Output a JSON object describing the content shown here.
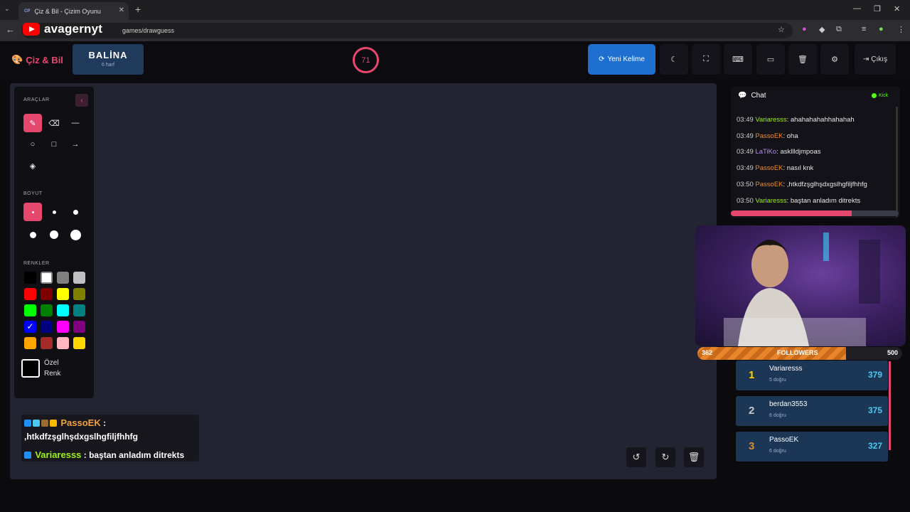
{
  "browser": {
    "tab_title": "Çiz & Bil - Çizim Oyunu",
    "tab_favicon": "CP",
    "url": "games/drawguess",
    "overlay_channel": "avagernyt"
  },
  "header": {
    "brand": "Çiz & Bil",
    "word": "BALİNA",
    "word_length": "6 harf",
    "timer": "71",
    "new_word_label": "Yeni Kelime",
    "exit_label": "Çıkış"
  },
  "tools": {
    "tools_label": "ARAÇLAR",
    "size_label": "BOYUT",
    "colors_label": "RENKLER",
    "custom_color_label_1": "Özel",
    "custom_color_label_2": "Renk",
    "palette": [
      "#000000",
      "#ffffff",
      "#808080",
      "#c0c0c0",
      "#ff0000",
      "#800000",
      "#ffff00",
      "#808000",
      "#00ff00",
      "#008000",
      "#00ffff",
      "#008080",
      "#0000ff",
      "#000080",
      "#ff00ff",
      "#800080",
      "#ffa500",
      "#a52a2a",
      "#ffb6c1",
      "#ffd700"
    ]
  },
  "canvas_chat": {
    "line1_user": "PassoEK",
    "line1_colon": ":",
    "line1_text": ",htkdfzşglhşdxgslhgfiljfhhfg",
    "line2_user": "Variaresss",
    "line2_text": ": baştan anladım ditrekts"
  },
  "chat": {
    "title": "Chat",
    "platform": "Kick",
    "messages": [
      {
        "time": "03:49",
        "user": "Variaresss",
        "color": "#9ef01a",
        "text": ": ahahahahahhahahah"
      },
      {
        "time": "03:49",
        "user": "PassoEK",
        "color": "#f28c28",
        "text": ": oha"
      },
      {
        "time": "03:49",
        "user": "LaTiKo",
        "color": "#b78cff",
        "text": ": askllldjmpoas"
      },
      {
        "time": "03:49",
        "user": "PassoEK",
        "color": "#f28c28",
        "text": ": nasıl knk"
      },
      {
        "time": "03:50",
        "user": "PassoEK",
        "color": "#f28c28",
        "text": ": ,htkdfzşglhşdxgslhgfiljfhhfg"
      },
      {
        "time": "03:50",
        "user": "Variaresss",
        "color": "#9ef01a",
        "text": ": baştan anladım ditrekts"
      }
    ],
    "progress_fraction": 0.72
  },
  "followers": {
    "current": "362",
    "label": "FOLLOWERS",
    "goal": "500",
    "fraction": 0.724
  },
  "leaderboard": [
    {
      "rank": "1",
      "name": "Variaresss",
      "sub": "5 doğru",
      "score": "379",
      "rank_color": "#ffd000"
    },
    {
      "rank": "2",
      "name": "berdan3553",
      "sub": "6 doğru",
      "score": "375",
      "rank_color": "#c8c8c8"
    },
    {
      "rank": "3",
      "name": "PassoEK",
      "sub": "6 doğru",
      "score": "327",
      "rank_color": "#d98b3a"
    }
  ]
}
